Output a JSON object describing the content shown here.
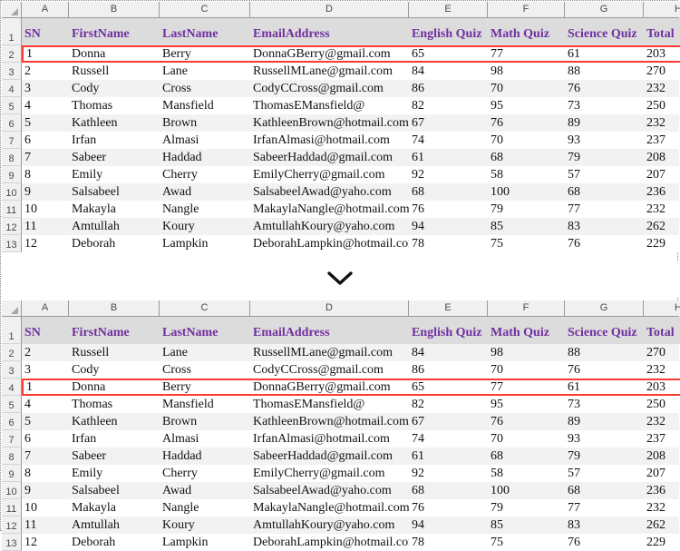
{
  "app": {
    "type": "spreadsheet",
    "accent_header_text": "#7030A0",
    "highlight_border": "#FF3B30",
    "band_color": "#F2F2F2",
    "header_fill": "#DCDCDC"
  },
  "column_headers": [
    "A",
    "B",
    "C",
    "D",
    "E",
    "F",
    "G",
    "H"
  ],
  "separator": {
    "icon": "chevron-down-icon"
  },
  "tables": [
    {
      "name": "before-table",
      "row_numbers": [
        "1",
        "2",
        "3",
        "4",
        "5",
        "6",
        "7",
        "8",
        "9",
        "10",
        "11",
        "12",
        "13"
      ],
      "field_headers": [
        "SN",
        "FirstName",
        "LastName",
        "EmailAddress",
        "English Quiz",
        "Math Quiz",
        "Science Quiz",
        "Total"
      ],
      "highlight_row_index": 0,
      "rows": [
        [
          "1",
          "Donna",
          "Berry",
          "DonnaGBerry@gmail.com",
          "65",
          "77",
          "61",
          "203"
        ],
        [
          "2",
          "Russell",
          "Lane",
          "RussellMLane@gmail.com",
          "84",
          "98",
          "88",
          "270"
        ],
        [
          "3",
          "Cody",
          "Cross",
          "CodyCCross@gmail.com",
          "86",
          "70",
          "76",
          "232"
        ],
        [
          "4",
          "Thomas",
          "Mansfield",
          "ThomasEMansfield@",
          "82",
          "95",
          "73",
          "250"
        ],
        [
          "5",
          "Kathleen",
          "Brown",
          "KathleenBrown@hotmail.com",
          "67",
          "76",
          "89",
          "232"
        ],
        [
          "6",
          "Irfan",
          "Almasi",
          "IrfanAlmasi@hotmail.com",
          "74",
          "70",
          "93",
          "237"
        ],
        [
          "7",
          "Sabeer",
          "Haddad",
          "SabeerHaddad@gmail.com",
          "61",
          "68",
          "79",
          "208"
        ],
        [
          "8",
          "Emily",
          "Cherry",
          "EmilyCherry@gmail.com",
          "92",
          "58",
          "57",
          "207"
        ],
        [
          "9",
          "Salsabeel",
          "Awad",
          "SalsabeelAwad@yaho.com",
          "68",
          "100",
          "68",
          "236"
        ],
        [
          "10",
          "Makayla",
          "Nangle",
          "MakaylaNangle@hotmail.com",
          "76",
          "79",
          "77",
          "232"
        ],
        [
          "11",
          "Amtullah",
          "Koury",
          "AmtullahKoury@yaho.com",
          "94",
          "85",
          "83",
          "262"
        ],
        [
          "12",
          "Deborah",
          "Lampkin",
          "DeborahLampkin@hotmail.com",
          "78",
          "75",
          "76",
          "229"
        ]
      ]
    },
    {
      "name": "after-table",
      "row_numbers": [
        "1",
        "2",
        "3",
        "4",
        "5",
        "6",
        "7",
        "8",
        "9",
        "10",
        "11",
        "12",
        "13"
      ],
      "field_headers": [
        "SN",
        "FirstName",
        "LastName",
        "EmailAddress",
        "English Quiz",
        "Math Quiz",
        "Science Quiz",
        "Total"
      ],
      "highlight_row_index": 2,
      "rows": [
        [
          "2",
          "Russell",
          "Lane",
          "RussellMLane@gmail.com",
          "84",
          "98",
          "88",
          "270"
        ],
        [
          "3",
          "Cody",
          "Cross",
          "CodyCCross@gmail.com",
          "86",
          "70",
          "76",
          "232"
        ],
        [
          "1",
          "Donna",
          "Berry",
          "DonnaGBerry@gmail.com",
          "65",
          "77",
          "61",
          "203"
        ],
        [
          "4",
          "Thomas",
          "Mansfield",
          "ThomasEMansfield@",
          "82",
          "95",
          "73",
          "250"
        ],
        [
          "5",
          "Kathleen",
          "Brown",
          "KathleenBrown@hotmail.com",
          "67",
          "76",
          "89",
          "232"
        ],
        [
          "6",
          "Irfan",
          "Almasi",
          "IrfanAlmasi@hotmail.com",
          "74",
          "70",
          "93",
          "237"
        ],
        [
          "7",
          "Sabeer",
          "Haddad",
          "SabeerHaddad@gmail.com",
          "61",
          "68",
          "79",
          "208"
        ],
        [
          "8",
          "Emily",
          "Cherry",
          "EmilyCherry@gmail.com",
          "92",
          "58",
          "57",
          "207"
        ],
        [
          "9",
          "Salsabeel",
          "Awad",
          "SalsabeelAwad@yaho.com",
          "68",
          "100",
          "68",
          "236"
        ],
        [
          "10",
          "Makayla",
          "Nangle",
          "MakaylaNangle@hotmail.com",
          "76",
          "79",
          "77",
          "232"
        ],
        [
          "11",
          "Amtullah",
          "Koury",
          "AmtullahKoury@yaho.com",
          "94",
          "85",
          "83",
          "262"
        ],
        [
          "12",
          "Deborah",
          "Lampkin",
          "DeborahLampkin@hotmail.com",
          "78",
          "75",
          "76",
          "229"
        ]
      ]
    }
  ]
}
